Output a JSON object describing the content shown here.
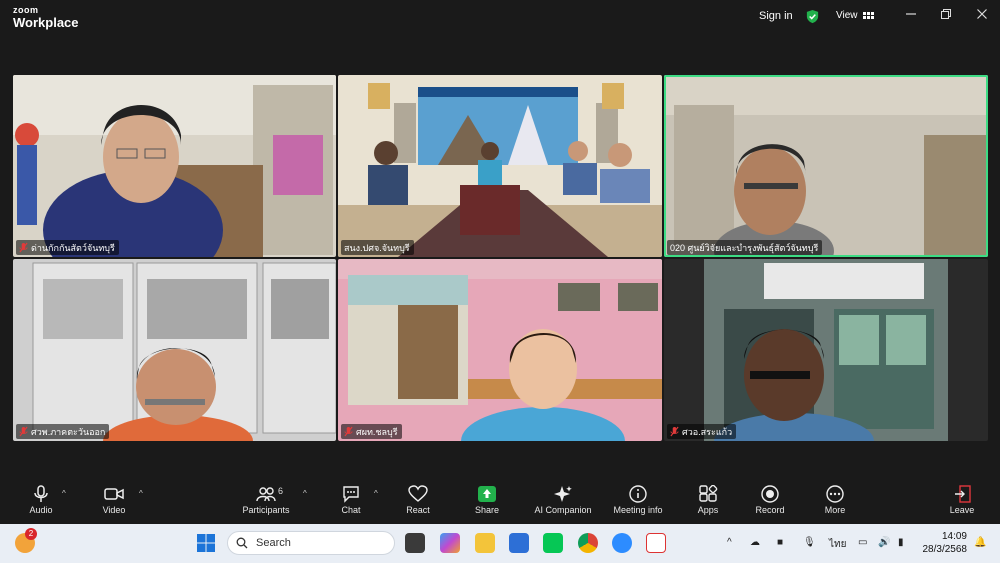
{
  "app": {
    "brand_small": "zoom",
    "brand_large": "Workplace"
  },
  "titlebar": {
    "signin_label": "Sign in",
    "view_label": "View"
  },
  "participants": [
    {
      "name": "ด่านกักกันสัตว์จันทบุรี",
      "muted": true,
      "active": false
    },
    {
      "name": "สนง.ปศจ.จันทบุรี",
      "muted": false,
      "active": false
    },
    {
      "name": "020 ศูนย์วิจัยและบำรุงพันธุ์สัตว์จันทบุรี",
      "muted": false,
      "active": true
    },
    {
      "name": "ศวพ.ภาคตะวันออก",
      "muted": true,
      "active": false
    },
    {
      "name": "ศผท.ชลบุรี",
      "muted": true,
      "active": false
    },
    {
      "name": "ศวอ.สระแก้ว",
      "muted": true,
      "active": false
    }
  ],
  "toolbar": {
    "audio": "Audio",
    "video": "Video",
    "participants": "Participants",
    "participants_count": "6",
    "chat": "Chat",
    "react": "React",
    "share": "Share",
    "ai_companion": "AI Companion",
    "meeting_info": "Meeting info",
    "apps": "Apps",
    "record": "Record",
    "more": "More",
    "leave": "Leave"
  },
  "taskbar": {
    "search_placeholder": "Search",
    "notification_count": "2",
    "language": "ไทย",
    "time": "14:09",
    "date": "28/3/2568"
  },
  "colors": {
    "active_speaker": "#3ddc84",
    "share_green": "#22b14c",
    "leave_red": "#e0383e"
  }
}
